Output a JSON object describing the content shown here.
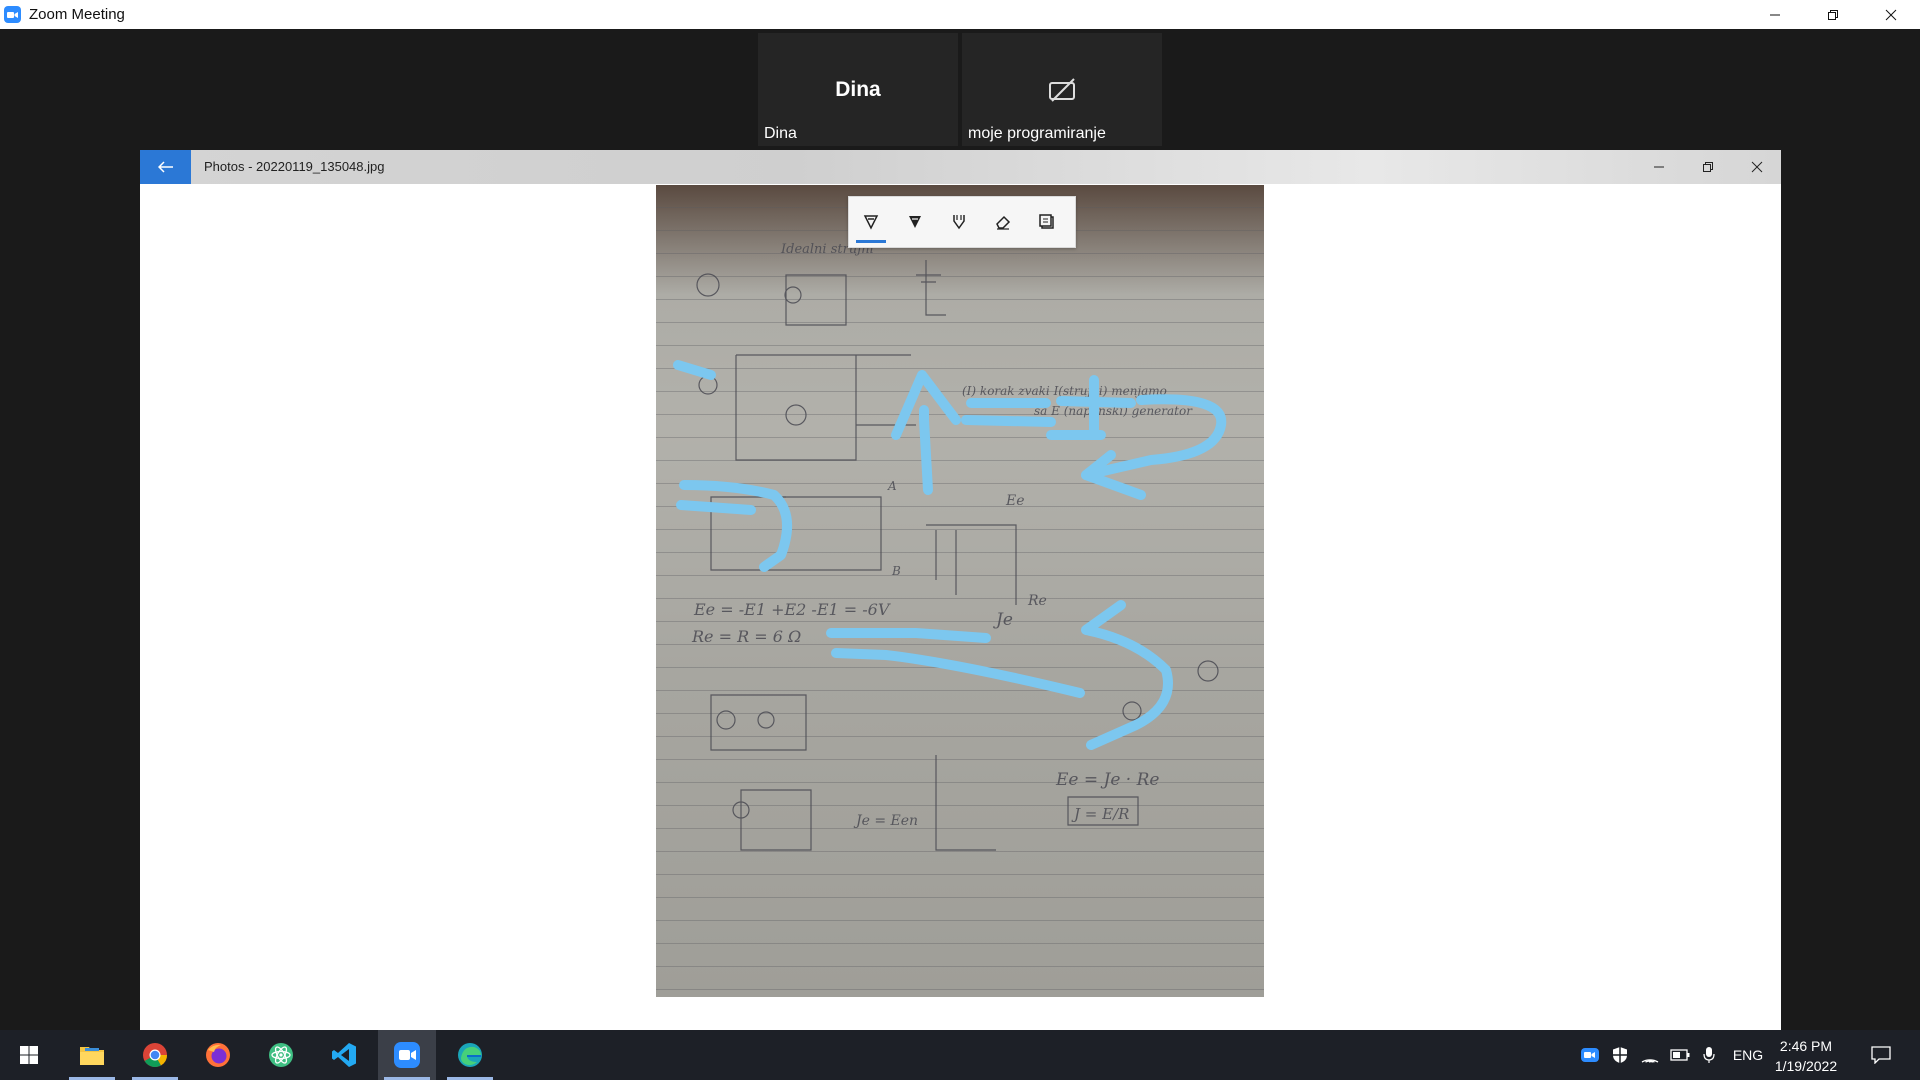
{
  "zoom": {
    "title": "Zoom Meeting",
    "participants": [
      {
        "display_name": "Dina",
        "label": "Dina"
      },
      {
        "label": "moje programiranje",
        "video": "off"
      }
    ]
  },
  "photos_app": {
    "title": "Photos - 20220119_135048.jpg",
    "ink_tools": [
      "ballpoint-pen",
      "pencil",
      "highlighter",
      "eraser",
      "ruler"
    ],
    "active_tool": "ballpoint-pen"
  },
  "notebook_photo": {
    "handwriting_samples": [
      "Idealni strujni",
      "(I) korak zvaki I(strujni) menjamo",
      "sa E (naponski) generator",
      "Ee = -E1 +E2 -E1 = -6V",
      "Re = R = 6 Ω",
      "Ee = Je · Re",
      "J = E/R",
      "Je = Een",
      "A",
      "B",
      "Ee",
      "Je",
      "Re"
    ]
  },
  "taskbar": {
    "apps": [
      "start",
      "file-explorer",
      "chrome",
      "firefox",
      "atom",
      "vscode",
      "zoom",
      "edge"
    ],
    "tray": {
      "lang": "ENG",
      "time": "2:46 PM",
      "date": "1/19/2022"
    }
  },
  "colors": {
    "annotation_blue": "#7cc7ef",
    "accent": "#2b78d6",
    "zoom_blue": "#2d8cff"
  }
}
